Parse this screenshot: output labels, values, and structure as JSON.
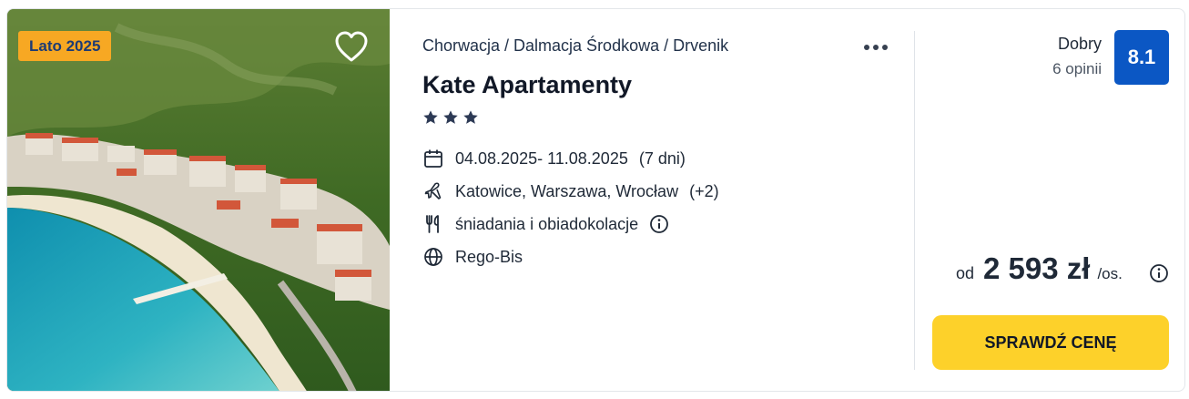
{
  "offer": {
    "season_badge": "Lato 2025",
    "breadcrumb": "Chorwacja / Dalmacja Środkowa / Drvenik",
    "title": "Kate Apartamenty",
    "stars": 3,
    "dates": "04.08.2025- 11.08.2025",
    "duration": "(7 dni)",
    "departures": "Katowice, Warszawa, Wrocław",
    "departures_more": "(+2)",
    "board": "śniadania i obiadokolacje",
    "operator": "Rego-Bis",
    "rating_word": "Dobry",
    "rating_count": "6 opinii",
    "score": "8.1",
    "price_prefix": "od",
    "price": "2 593 zł",
    "price_suffix": "/os.",
    "cta_label": "SPRAWDŹ CENĘ"
  },
  "colors": {
    "badge": "#f7a823",
    "score": "#0b57c4",
    "cta": "#fdd12a"
  },
  "icons": [
    "heart-icon",
    "more-icon",
    "star-icon",
    "calendar-icon",
    "plane-icon",
    "fork-knife-icon",
    "info-icon",
    "globe-icon"
  ]
}
